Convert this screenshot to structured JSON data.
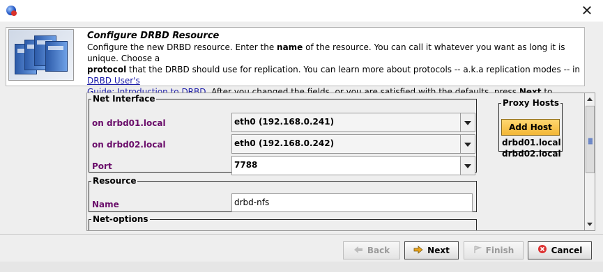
{
  "window": {
    "close_label": "✕"
  },
  "info": {
    "title": "Configure DRBD Resource",
    "line1_a": "Configure the new DRBD resource. Enter the ",
    "line1_b": "name",
    "line1_c": " of the resource. You can call it whatever you want as long it is unique. Choose a",
    "line2_a": "protocol",
    "line2_b": " that the DRBD should use for replication. You can learn more about protocols -- a.k.a replication modes -- in ",
    "link_a": "DRBD User's",
    "link_b": "Guide: Introduction to DRBD",
    "line3_b": ". After you changed the fields, or you are satisfied with the defaults, press ",
    "line3_c": "Next",
    "line3_d": " to continue."
  },
  "net_interface": {
    "legend": "Net Interface",
    "host1_label": "on drbd01.local",
    "host1_value": "eth0 (192.168.0.241)",
    "host2_label": "on drbd02.local",
    "host2_value": "eth0 (192.168.0.242)",
    "port_label": "Port",
    "port_value": "7788"
  },
  "resource": {
    "legend": "Resource",
    "name_label": "Name",
    "name_value": "drbd-nfs"
  },
  "net_options": {
    "legend": "Net-options"
  },
  "proxy_hosts": {
    "legend": "Proxy Hosts",
    "add_label": "Add Host",
    "hosts": [
      "drbd01.local",
      "drbd02.local"
    ]
  },
  "buttons": {
    "back": "Back",
    "next": "Next",
    "finish": "Finish",
    "cancel": "Cancel"
  }
}
